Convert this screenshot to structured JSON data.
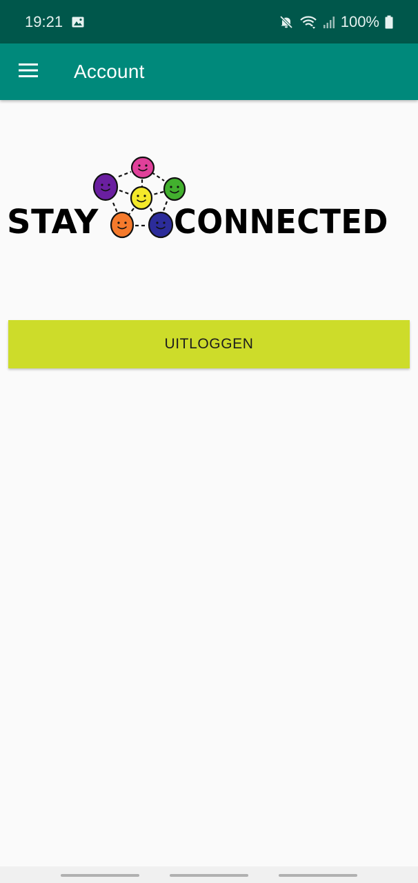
{
  "status_bar": {
    "time": "19:21",
    "battery": "100%",
    "icons": [
      "image-icon",
      "mute-icon",
      "wifi-icon",
      "signal-icon",
      "battery-icon"
    ]
  },
  "app_bar": {
    "title": "Account",
    "menu_icon": "hamburger-menu-icon",
    "background": "#00897b",
    "status_background": "#00574b"
  },
  "logo": {
    "word_left": "STAY",
    "word_right": "CONNECTED",
    "face_colors": [
      "#e0409a",
      "#6a1fa0",
      "#42b02e",
      "#f4e92a",
      "#f57a2c",
      "#2c2c9a"
    ]
  },
  "actions": {
    "logout_label": "UITLOGGEN",
    "logout_color": "#cddc2a"
  },
  "nav_bar": {
    "items": [
      "nav-pill-left",
      "nav-pill-center",
      "nav-pill-right"
    ]
  }
}
